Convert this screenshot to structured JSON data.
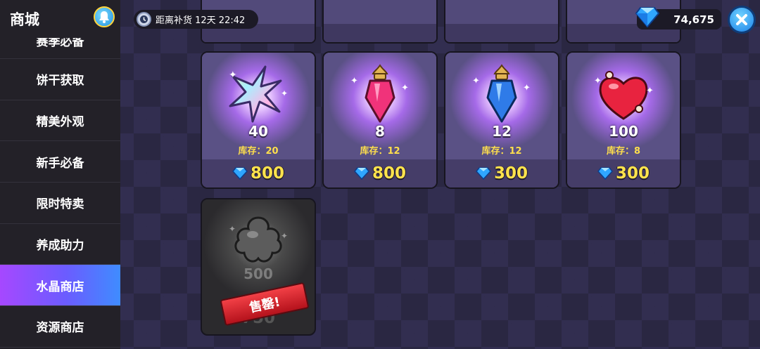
{
  "sidebar": {
    "title": "商城",
    "items": [
      {
        "label": "赛季必备"
      },
      {
        "label": "饼干获取"
      },
      {
        "label": "精美外观"
      },
      {
        "label": "新手必备"
      },
      {
        "label": "限时特卖"
      },
      {
        "label": "养成助力"
      },
      {
        "label": "水晶商店",
        "active": true
      },
      {
        "label": "资源商店"
      }
    ]
  },
  "topbar": {
    "restock_text": "距离补货 12天 22:42",
    "gem_balance": "74,675"
  },
  "cards": [
    {
      "amount": "40",
      "stock": "库存：20",
      "price": "800",
      "icon": "rainbow-star-icon"
    },
    {
      "amount": "8",
      "stock": "库存：12",
      "price": "800",
      "icon": "pink-crystal-icon"
    },
    {
      "amount": "12",
      "stock": "库存：12",
      "price": "300",
      "icon": "blue-crystal-icon"
    },
    {
      "amount": "100",
      "stock": "库存：8",
      "price": "300",
      "icon": "red-heart-icon"
    },
    {
      "amount": "500",
      "price": "750",
      "icon": "grey-cloud-icon",
      "sold_out_label": "售罄!"
    }
  ],
  "colors": {
    "accent_yellow": "#ffe34d",
    "active_tab_start": "#a648ff",
    "active_tab_end": "#3f8cff",
    "sold_red": "#e0262e"
  }
}
